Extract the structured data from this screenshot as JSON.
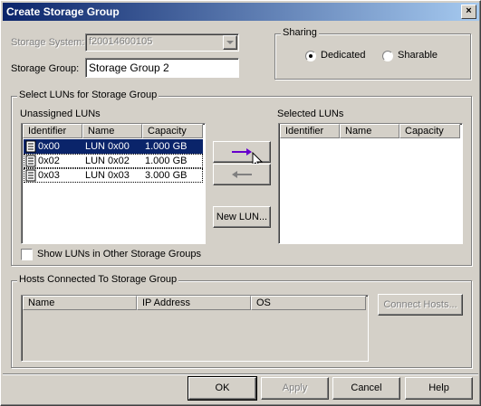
{
  "window": {
    "title": "Create Storage Group",
    "close_glyph": "×"
  },
  "form": {
    "storage_system_label": "Storage System:",
    "storage_system_value": "f20014600105",
    "storage_group_label": "Storage Group:",
    "storage_group_value": "Storage Group 2"
  },
  "sharing": {
    "title": "Sharing",
    "options": [
      {
        "label": "Dedicated",
        "selected": true
      },
      {
        "label": "Sharable",
        "selected": false
      }
    ]
  },
  "luns": {
    "title": "Select LUNs for Storage Group",
    "unassigned_label": "Unassigned LUNs",
    "selected_label": "Selected LUNs",
    "columns": [
      "Identifier",
      "Name",
      "Capacity"
    ],
    "unassigned_rows": [
      {
        "identifier": "0x00",
        "name": "LUN 0x00",
        "capacity": "1.000 GB",
        "selected": true
      },
      {
        "identifier": "0x02",
        "name": "LUN 0x02",
        "capacity": "1.000 GB",
        "selected": false
      },
      {
        "identifier": "0x03",
        "name": "LUN 0x03",
        "capacity": "3.000 GB",
        "selected": false
      }
    ],
    "new_lun_label": "New LUN...",
    "show_other_label": "Show LUNs in Other Storage Groups",
    "move_right_icon": "arrow-right-icon",
    "move_left_icon": "arrow-left-icon"
  },
  "hosts": {
    "title": "Hosts Connected To Storage Group",
    "columns": [
      "Name",
      "IP Address",
      "OS"
    ],
    "connect_label": "Connect Hosts..."
  },
  "buttons": {
    "ok": "OK",
    "apply": "Apply",
    "cancel": "Cancel",
    "help": "Help"
  },
  "colors": {
    "title_bar": "#0a246a",
    "selection": "#0a246a",
    "arrow_active": "#6600cc",
    "face": "#d4d0c8"
  }
}
